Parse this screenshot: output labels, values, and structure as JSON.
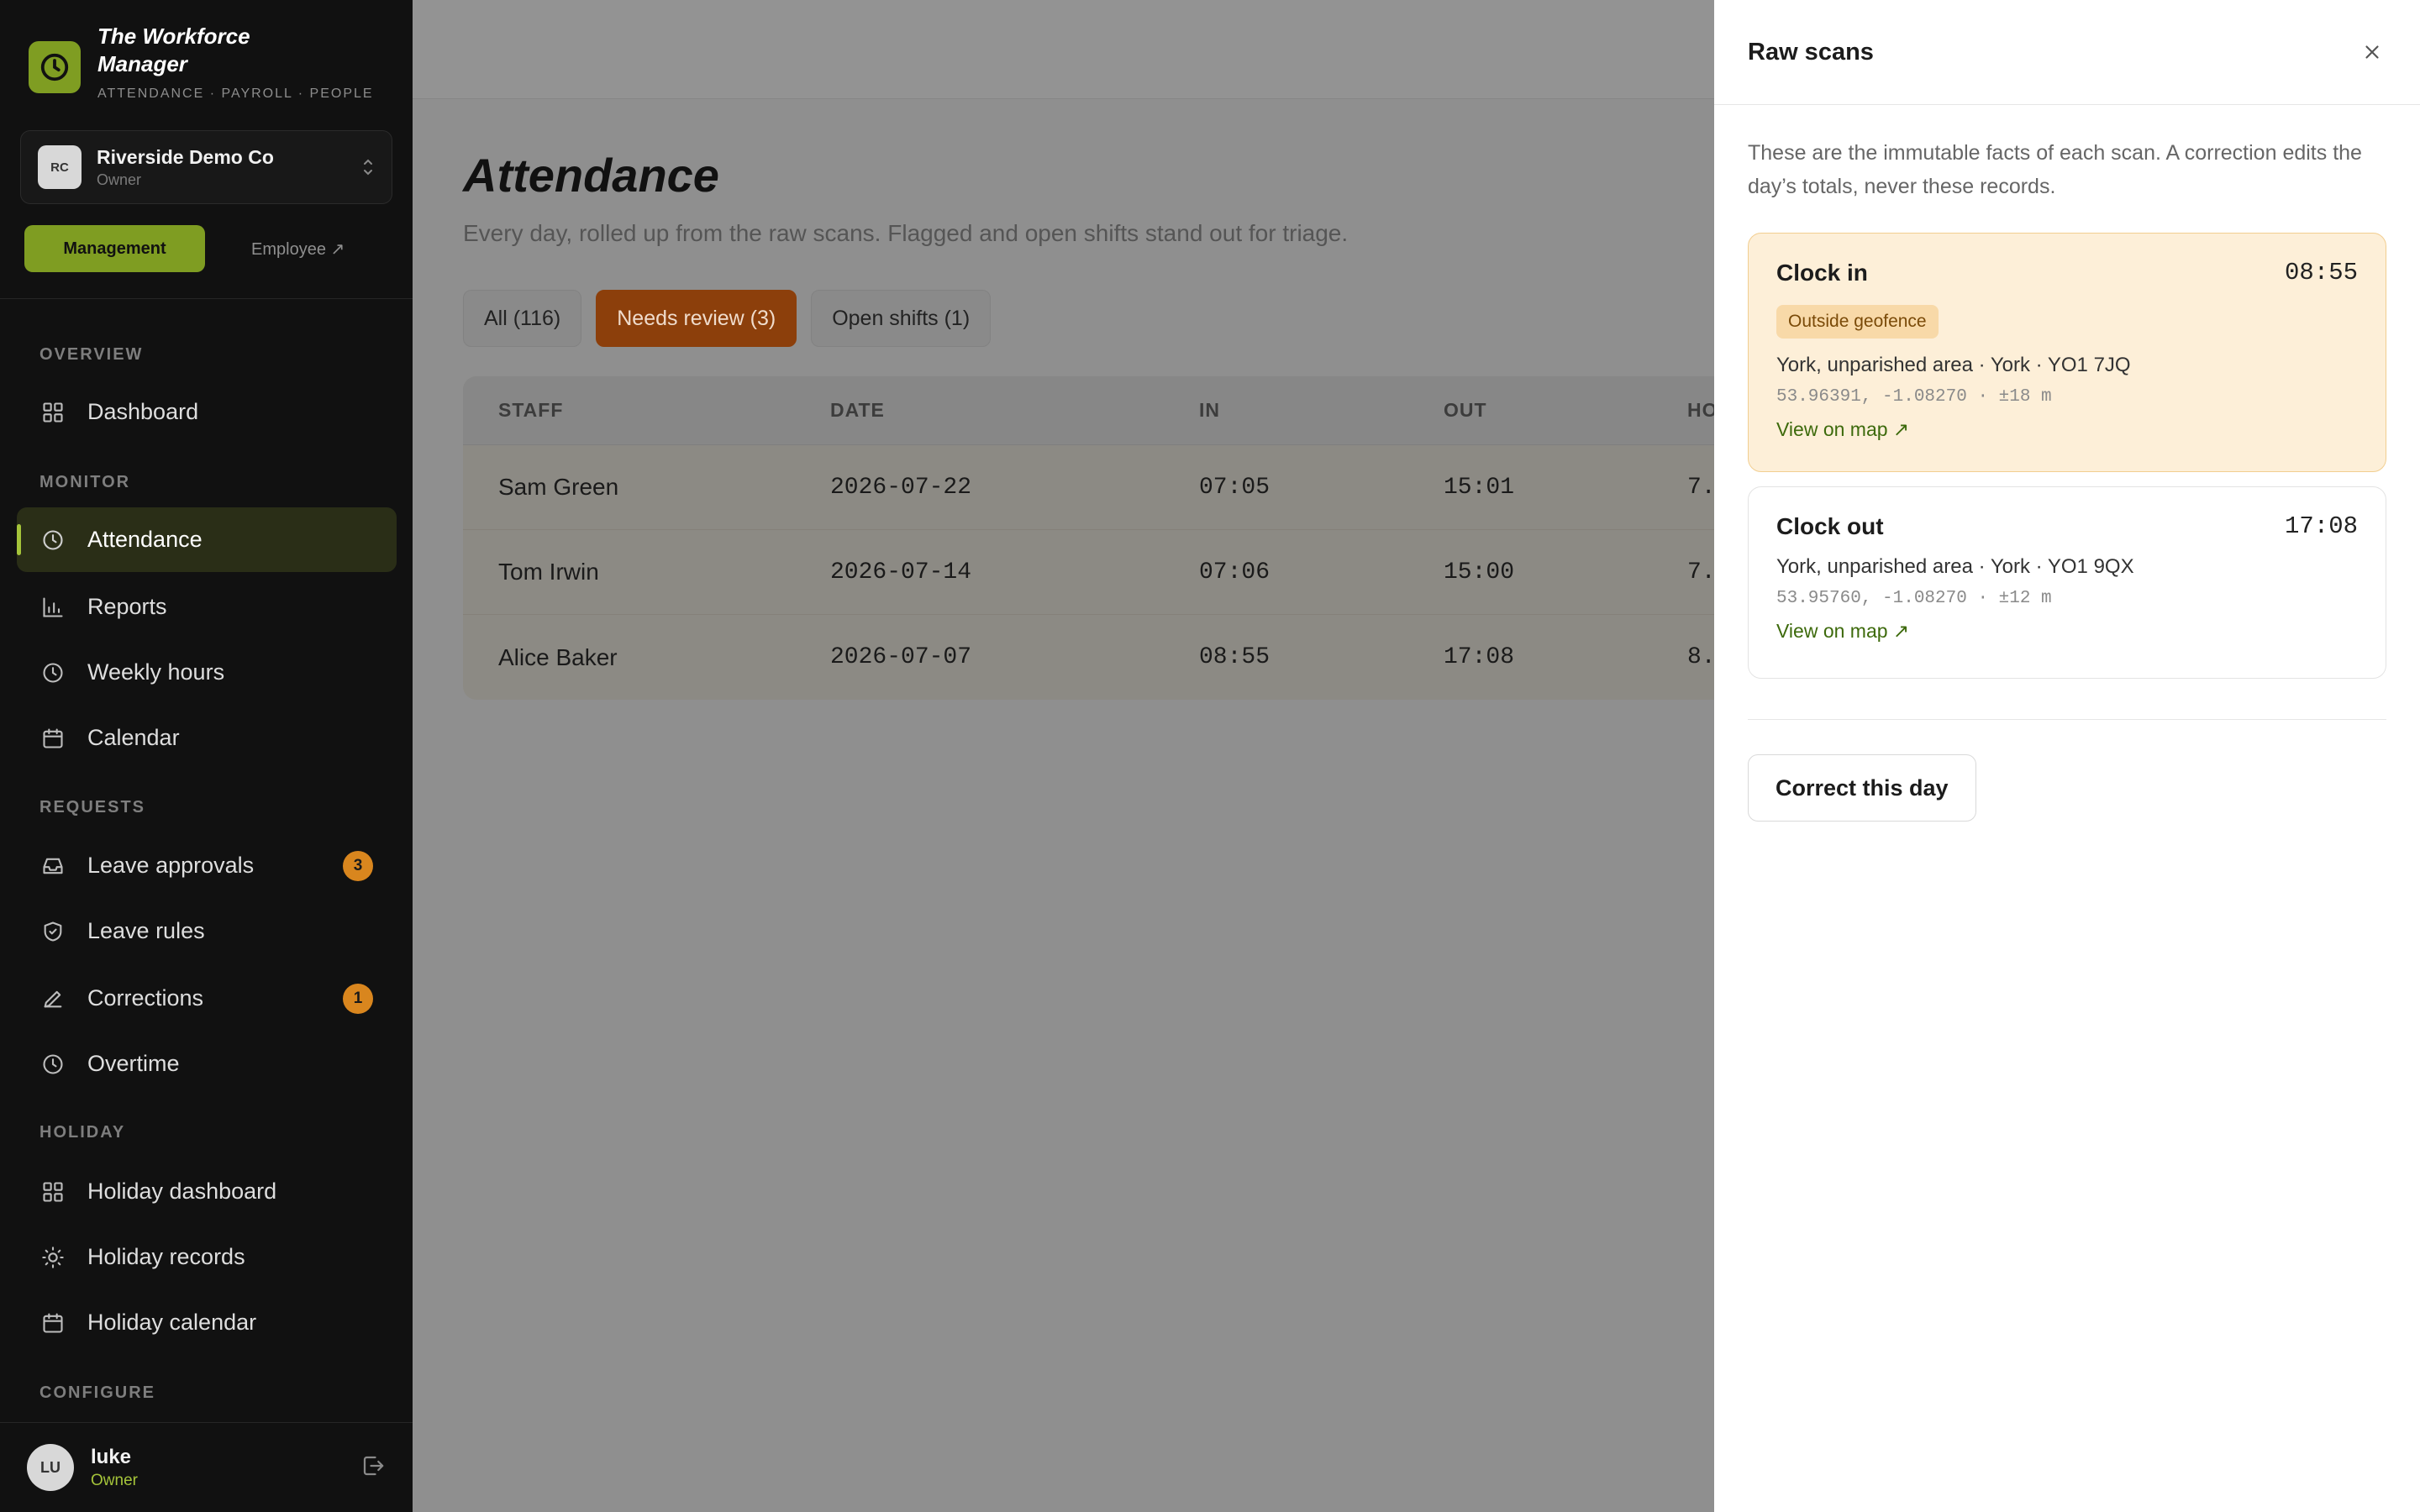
{
  "brand": {
    "title": "The Workforce Manager",
    "subtitle": "ATTENDANCE · PAYROLL · PEOPLE"
  },
  "org": {
    "initials": "RC",
    "name": "Riverside Demo Co",
    "role": "Owner"
  },
  "mode": {
    "management_label": "Management",
    "employee_label": "Employee ↗"
  },
  "nav": {
    "overview_label": "OVERVIEW",
    "dashboard": "Dashboard",
    "monitor_label": "MONITOR",
    "attendance": "Attendance",
    "reports": "Reports",
    "weekly_hours": "Weekly hours",
    "calendar": "Calendar",
    "requests_label": "REQUESTS",
    "leave_approvals": "Leave approvals",
    "leave_approvals_badge": "3",
    "leave_rules": "Leave rules",
    "corrections": "Corrections",
    "corrections_badge": "1",
    "overtime": "Overtime",
    "holiday_label": "HOLIDAY",
    "holiday_dashboard": "Holiday dashboard",
    "holiday_records": "Holiday records",
    "holiday_calendar": "Holiday calendar",
    "configure_label": "CONFIGURE"
  },
  "user": {
    "initials": "LU",
    "name": "luke",
    "role": "Owner"
  },
  "page": {
    "title": "Attendance",
    "subtitle": "Every day, rolled up from the raw scans. Flagged and open shifts stand out for triage."
  },
  "filters": {
    "all": "All (116)",
    "needs_review": "Needs review (3)",
    "open_shifts": "Open shifts (1)"
  },
  "table": {
    "headers": {
      "staff": "STAFF",
      "date": "DATE",
      "in": "IN",
      "out": "OUT",
      "hours": "HO"
    },
    "rows": [
      {
        "staff": "Sam Green",
        "date": "2026-07-22",
        "in": "07:05",
        "out": "15:01",
        "hours": "7."
      },
      {
        "staff": "Tom Irwin",
        "date": "2026-07-14",
        "in": "07:06",
        "out": "15:00",
        "hours": "7."
      },
      {
        "staff": "Alice Baker",
        "date": "2026-07-07",
        "in": "08:55",
        "out": "17:08",
        "hours": "8."
      }
    ]
  },
  "drawer": {
    "title": "Raw scans",
    "description": "These are the immutable facts of each scan. A correction edits the day’s totals, never these records.",
    "clock_in": {
      "label": "Clock in",
      "time": "08:55",
      "badge": "Outside geofence",
      "address": "York, unparished area · York · YO1 7JQ",
      "coords": "53.96391, -1.08270 · ±18 m",
      "link": "View on map ↗"
    },
    "clock_out": {
      "label": "Clock out",
      "time": "17:08",
      "address": "York, unparished area · York · YO1 9QX",
      "coords": "53.95760, -1.08270 · ±12 m",
      "link": "View on map ↗"
    },
    "correct_button": "Correct this day"
  },
  "colors": {
    "accent": "#7f9d22",
    "sidebar_bg": "#111111",
    "badge": "#d9861e",
    "needs_review": "#8c3f0b",
    "flag_bg": "#fdefd8"
  }
}
